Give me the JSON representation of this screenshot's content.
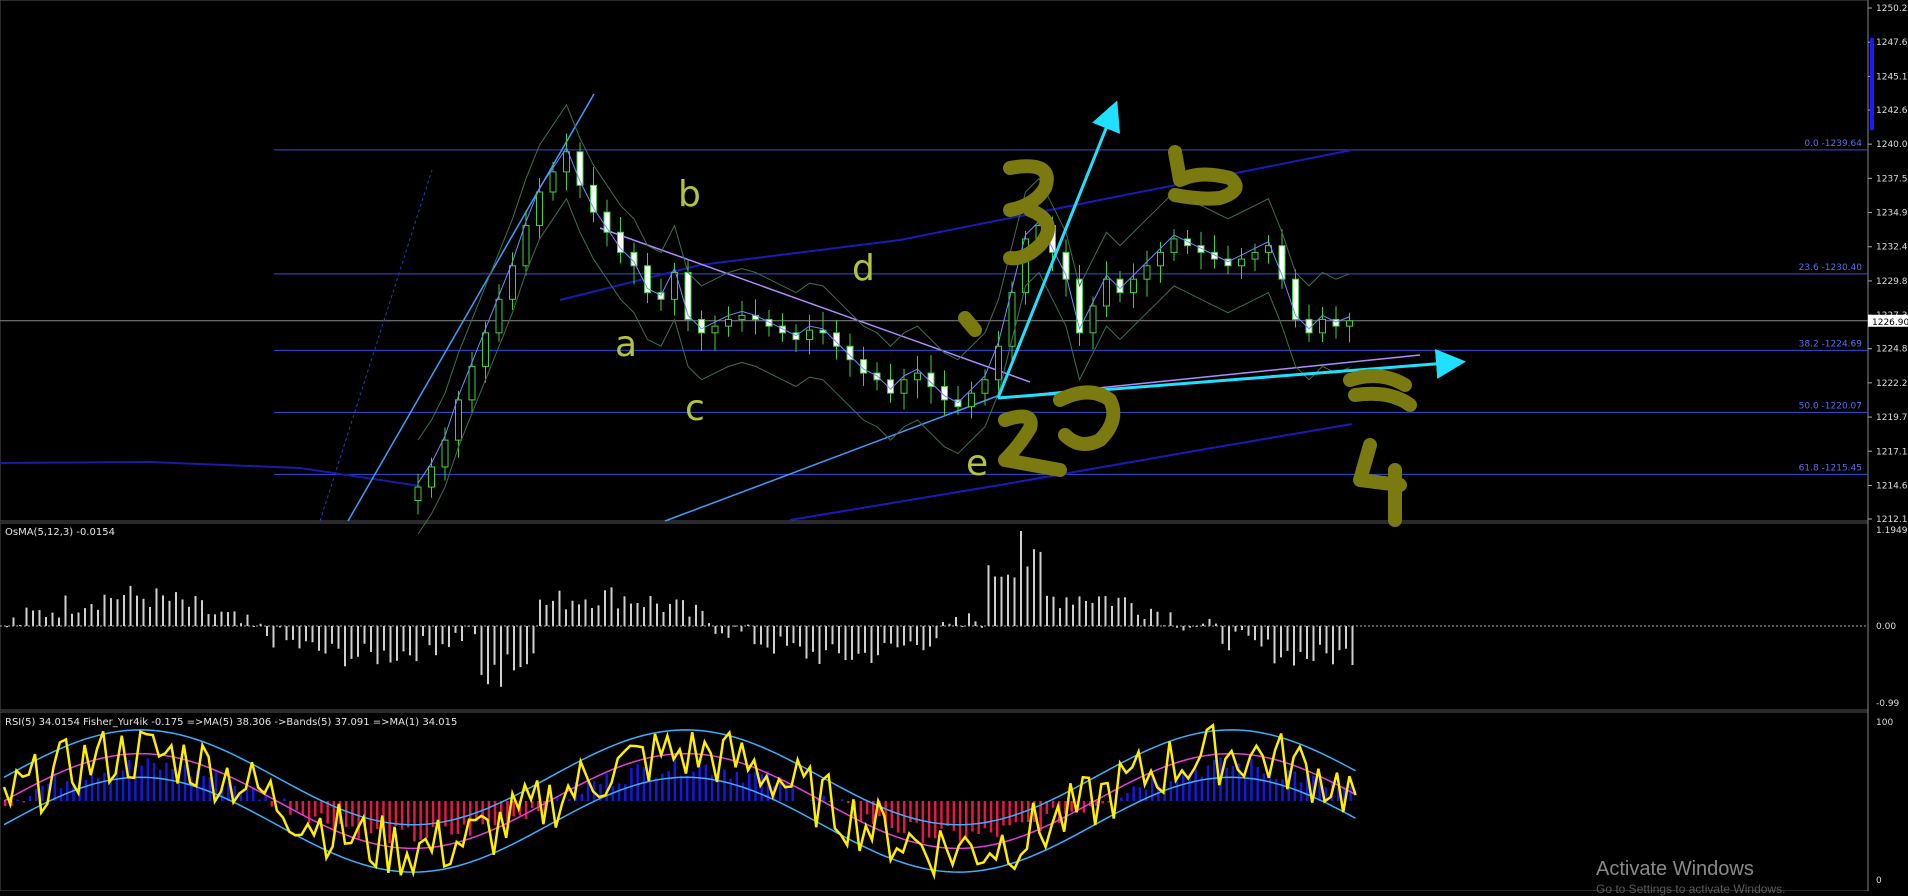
{
  "main_chart": {
    "price_axis_labels": [
      "1250.22",
      "1247.67",
      "1245.12",
      "1242.62",
      "1240.07",
      "1237.52",
      "1234.97",
      "1232.42",
      "1229.87",
      "1227.32",
      "1224.82",
      "1222.27",
      "1219.72",
      "1217.17",
      "1214.62",
      "1212.12"
    ],
    "current_price": "1226.90",
    "fib_levels": [
      {
        "label": "0.0 -1239.64",
        "price": 1239.64
      },
      {
        "label": "23.6 -1230.40",
        "price": 1230.4
      },
      {
        "label": "38.2 -1224.69",
        "price": 1224.69
      },
      {
        "label": "50.0 -1220.07",
        "price": 1220.07
      },
      {
        "label": "61.8 -1215.45",
        "price": 1215.45
      }
    ],
    "wave_letters": [
      "a",
      "b",
      "c",
      "d",
      "e"
    ],
    "handwritten_marks": [
      "3",
      "b",
      "2",
      "2",
      "c",
      "4",
      "'"
    ]
  },
  "osma": {
    "label": "OsMA(5,12,3) -0.0154",
    "axis_labels": [
      "1.1949",
      "0.00",
      "-0.99"
    ]
  },
  "rsi": {
    "label": "RSI(5) 34.0154  Fisher_Yur4ik -0.175  =>MA(5) 38.306  ->Bands(5) 37.091  =>MA(1) 34.015",
    "axis_labels": [
      "100",
      "0"
    ]
  },
  "watermark": {
    "title": "Activate Windows",
    "subtitle": "Go to Settings to activate Windows."
  },
  "colors": {
    "background": "#000000",
    "candle": "#3cd23c",
    "fib": "#2f4fd8",
    "trend_light": "#3aa0ff",
    "arrow": "#20e0ff",
    "annotation": "#7a7a10",
    "letters": "#b4c43a",
    "rsi_yellow": "#ffee00",
    "hist_blue": "#1616e6",
    "hist_red": "#e6164a"
  }
}
